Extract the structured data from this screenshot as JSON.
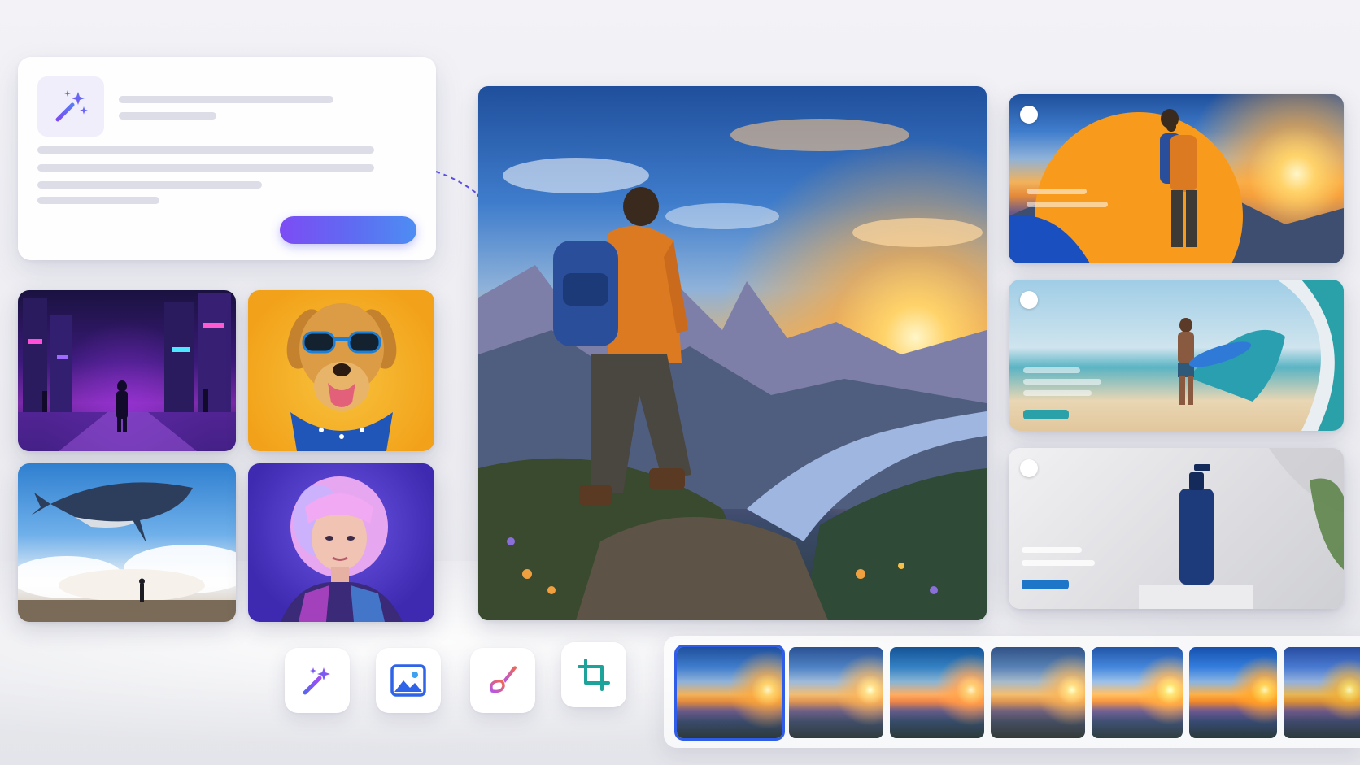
{
  "prompt_panel": {
    "icon": "magic-wand-sparkle-icon",
    "accent_gradient": [
      "#7d4cf4",
      "#4d8ef3"
    ]
  },
  "gallery": {
    "tiles": [
      {
        "name": "neon-city-image",
        "subject": "neon-city-street"
      },
      {
        "name": "dog-sunglasses-image",
        "subject": "dog-in-sunglasses"
      },
      {
        "name": "flying-whale-image",
        "subject": "whale-over-clouds"
      },
      {
        "name": "neon-portrait-image",
        "subject": "pink-haired-portrait"
      }
    ]
  },
  "main_image": {
    "subject": "hiker-mountain-sunset"
  },
  "templates": [
    {
      "name": "template-hiker",
      "shape_colors": [
        "#f89a1c",
        "#1a4fc0"
      ]
    },
    {
      "name": "template-surfer",
      "shape_colors": [
        "#2aa0a8",
        "#e9eef2"
      ]
    },
    {
      "name": "template-product",
      "shape_colors": [
        "#1d76c8",
        "#e8e8ec"
      ]
    }
  ],
  "toolbar": {
    "tools": [
      {
        "name": "magic-tool",
        "icon": "magic-wand-icon",
        "color": "#6a55f0"
      },
      {
        "name": "image-tool",
        "icon": "image-icon",
        "color": "#2f63e8"
      },
      {
        "name": "brush-tool",
        "icon": "brush-icon",
        "color": "#e0508a"
      },
      {
        "name": "crop-tool",
        "icon": "crop-icon",
        "color": "#1ea39a"
      }
    ]
  },
  "filmstrip": {
    "thumbnails": 7,
    "selected_index": 0,
    "selected_color": "#2f5de8"
  }
}
